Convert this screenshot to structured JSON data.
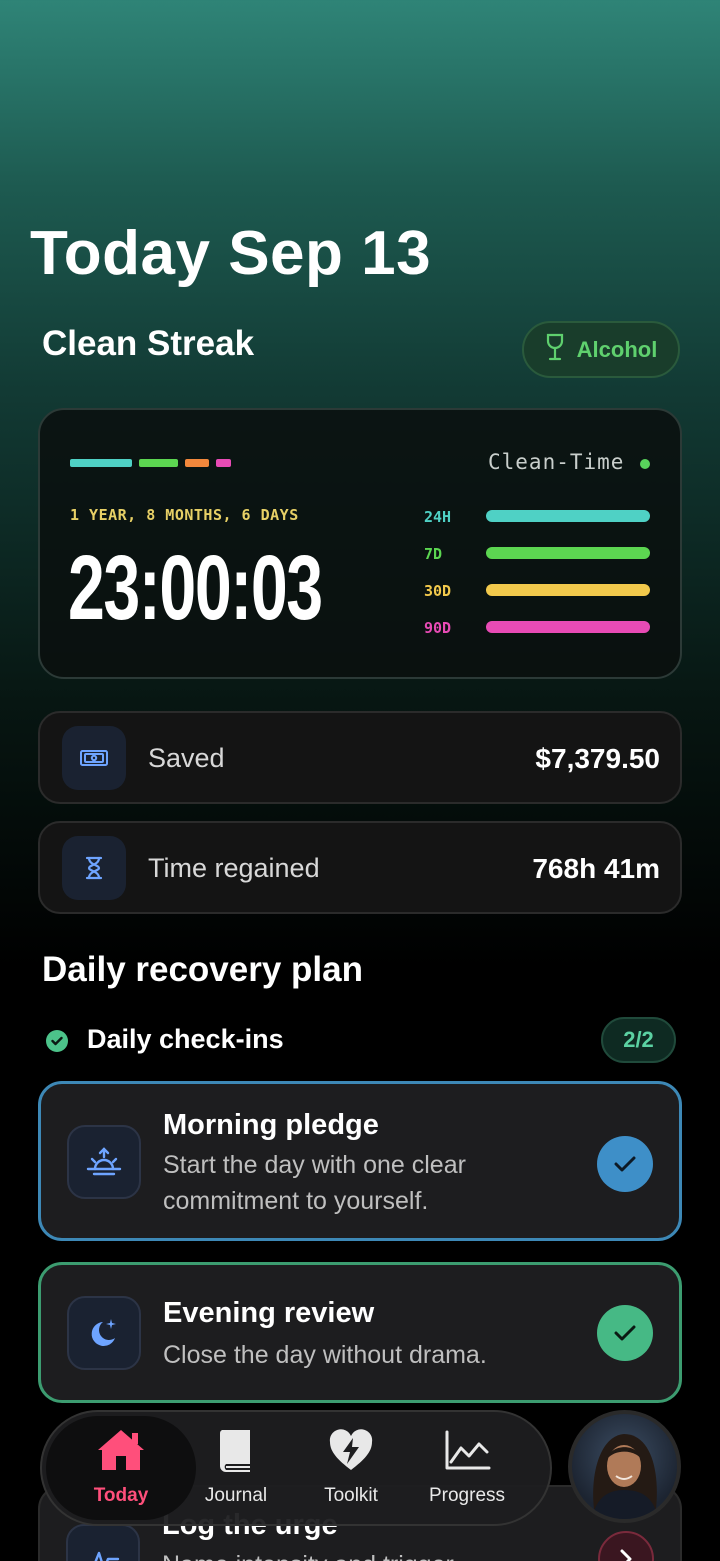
{
  "header": {
    "title": "Today Sep 13"
  },
  "streak": {
    "section_title": "Clean Streak",
    "addiction_label": "Alcohol",
    "clean_time_label": "Clean-Time",
    "duration_text": "1 YEAR, 8 MONTHS, 6 DAYS",
    "timer": "23:00:03",
    "periods": [
      {
        "label": "24H",
        "color": "#4fd1c5"
      },
      {
        "label": "7D",
        "color": "#5cd651"
      },
      {
        "label": "30D",
        "color": "#f2c94c"
      },
      {
        "label": "90D",
        "color": "#e84bb5"
      }
    ],
    "accent_colors": [
      "#4fd1c5",
      "#5cd651",
      "#f2883c",
      "#e84bb5"
    ]
  },
  "stats": [
    {
      "label": "Saved",
      "value": "$7,379.50",
      "icon": "cash-icon"
    },
    {
      "label": "Time regained",
      "value": "768h 41m",
      "icon": "hourglass-icon"
    }
  ],
  "plan": {
    "title": "Daily recovery plan",
    "checkins_label": "Daily check-ins",
    "checkins_count": "2/2",
    "tasks": [
      {
        "title": "Morning pledge",
        "description": "Start the day with one clear commitment to yourself.",
        "icon": "sunrise-icon",
        "border_color": "#3d88b6",
        "check_color": "#3e8fc8"
      },
      {
        "title": "Evening review",
        "description": "Close the day without drama.",
        "icon": "moon-stars-icon",
        "border_color": "#3c9c70",
        "check_color": "#46b985"
      },
      {
        "title": "Log the urge",
        "description": "Name intensity and trigger",
        "icon": "pulse-icon"
      }
    ]
  },
  "tabbar": {
    "tabs": [
      {
        "label": "Today",
        "icon": "home-icon",
        "active": true,
        "color": "#ff4f7b"
      },
      {
        "label": "Journal",
        "icon": "book-icon"
      },
      {
        "label": "Toolkit",
        "icon": "heart-bolt-icon"
      },
      {
        "label": "Progress",
        "icon": "chart-icon"
      }
    ]
  }
}
